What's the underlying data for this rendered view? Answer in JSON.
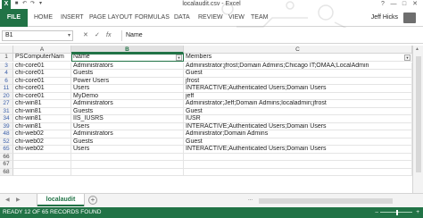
{
  "window": {
    "title": "localaudit.csv - Excel",
    "app_icon": "X",
    "quick_access": [
      "save-icon",
      "undo-icon",
      "redo-icon",
      "customize-icon"
    ],
    "controls": [
      "?",
      "—",
      "□",
      "✕"
    ]
  },
  "ribbon": {
    "file_label": "FILE",
    "tabs": [
      "HOME",
      "INSERT",
      "PAGE LAYOUT",
      "FORMULAS",
      "DATA",
      "REVIEW",
      "VIEW",
      "TEAM"
    ],
    "user": "Jeff Hicks"
  },
  "formula_bar": {
    "name_box": "B1",
    "cancel_icon": "✕",
    "enter_icon": "✓",
    "fx_label": "fx",
    "value": "Name"
  },
  "columns": [
    "A",
    "B",
    "C"
  ],
  "headers": [
    "PSComputerNam",
    "Name",
    "Members"
  ],
  "rows": [
    {
      "num": "3",
      "a": "chi-core01",
      "b": "Administrators",
      "c": "Administrator;jfrost;Domain Admins;Chicago IT;OMAA;LocalAdmin"
    },
    {
      "num": "4",
      "a": "chi-core01",
      "b": "Guests",
      "c": "Guest"
    },
    {
      "num": "6",
      "a": "chi-core01",
      "b": "Power Users",
      "c": "jfrost"
    },
    {
      "num": "11",
      "a": "chi-core01",
      "b": "Users",
      "c": "INTERACTIVE;Authenticated Users;Domain Users"
    },
    {
      "num": "20",
      "a": "chi-core01",
      "b": "MyDemo",
      "c": "jeff"
    },
    {
      "num": "27",
      "a": "chi-win81",
      "b": "Administrators",
      "c": "Administrator;Jeff;Domain Admins;localadmin;jfrost"
    },
    {
      "num": "31",
      "a": "chi-win81",
      "b": "Guests",
      "c": "Guest"
    },
    {
      "num": "34",
      "a": "chi-win81",
      "b": "IIS_IUSRS",
      "c": "IUSR"
    },
    {
      "num": "39",
      "a": "chi-win81",
      "b": "Users",
      "c": "INTERACTIVE;Authenticated Users;Domain Users"
    },
    {
      "num": "48",
      "a": "chi-web02",
      "b": "Administrators",
      "c": "Administrator;Domain Admins"
    },
    {
      "num": "52",
      "a": "chi-web02",
      "b": "Guests",
      "c": "Guest"
    },
    {
      "num": "65",
      "a": "chi-web02",
      "b": "Users",
      "c": "INTERACTIVE;Authenticated Users;Domain Users"
    },
    {
      "num": "66",
      "a": "",
      "b": "",
      "c": ""
    },
    {
      "num": "67",
      "a": "",
      "b": "",
      "c": ""
    },
    {
      "num": "68",
      "a": "",
      "b": "",
      "c": ""
    }
  ],
  "sheet": {
    "tab_label": "localaudit",
    "add_label": "+",
    "prev_arrow": "◀",
    "next_arrow": "▶",
    "more": "..."
  },
  "status": {
    "text": "READY   12 OF 65 RECORDS FOUND",
    "zoom_minus": "–",
    "zoom_plus": "+"
  },
  "colors": {
    "accent": "#217346",
    "row_number_filtered": "#3b5fa8"
  }
}
